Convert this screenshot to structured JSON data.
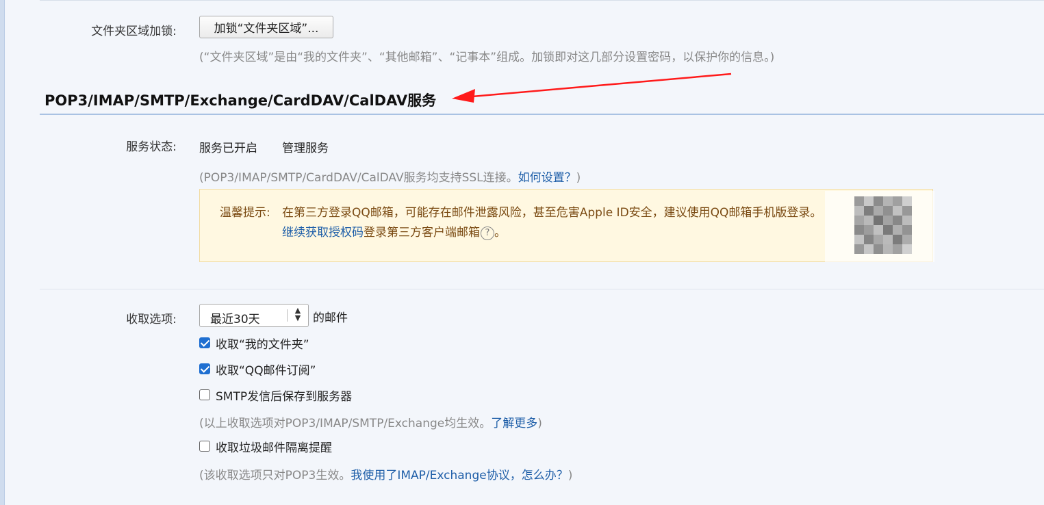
{
  "colors": {
    "link": "#1e5ea8",
    "hint": "#888888",
    "notice_bg": "#fff8e1",
    "notice_text": "#7a4a12",
    "checkbox_checked": "#1f6fd1",
    "annotation_arrow": "#ff1a1a"
  },
  "folder_lock": {
    "label": "文件夹区域加锁:",
    "button_label": "加锁“文件夹区域”...",
    "hint": "(“文件夹区域”是由“我的文件夹”、“其他邮箱”、“记事本”组成。加锁即对这几部分设置密码，以保护你的信息。)"
  },
  "section": {
    "title": "POP3/IMAP/SMTP/Exchange/CardDAV/CalDAV服务"
  },
  "service": {
    "label": "服务状态:",
    "status": "服务已开启",
    "manage_link": "管理服务",
    "ssl_hint_prefix": "(POP3/IMAP/SMTP/CardDAV/CalDAV服务均支持SSL连接。",
    "ssl_hint_link": "如何设置？",
    "ssl_hint_suffix": ")"
  },
  "notice": {
    "prefix": "温馨提示:",
    "line1": "在第三方登录QQ邮箱，可能存在邮件泄露风险，甚至危害Apple ID安全，建议使用QQ邮箱手机版登录。",
    "line2_link": "继续获取授权码",
    "line2_text": "登录第三方客户端邮箱",
    "help_icon": "question-circle-icon",
    "line2_end": "。",
    "qr_icon": "qr-code-blurred"
  },
  "receive": {
    "label": "收取选项:",
    "range_value": "最近30天",
    "range_suffix": "的邮件",
    "options": [
      {
        "label": "收取“我的文件夹”",
        "checked": true
      },
      {
        "label": "收取“QQ邮件订阅”",
        "checked": true
      },
      {
        "label": "SMTP发信后保存到服务器",
        "checked": false
      }
    ],
    "hint1_prefix": "(以上收取选项对POP3/IMAP/SMTP/Exchange均生效。",
    "hint1_link": "了解更多",
    "hint1_suffix": ")",
    "spam_option": {
      "label": "收取垃圾邮件隔离提醒",
      "checked": false
    },
    "hint2_prefix": "(该收取选项只对POP3生效。",
    "hint2_link": "我使用了IMAP/Exchange协议，怎么办？",
    "hint2_suffix": ")"
  }
}
